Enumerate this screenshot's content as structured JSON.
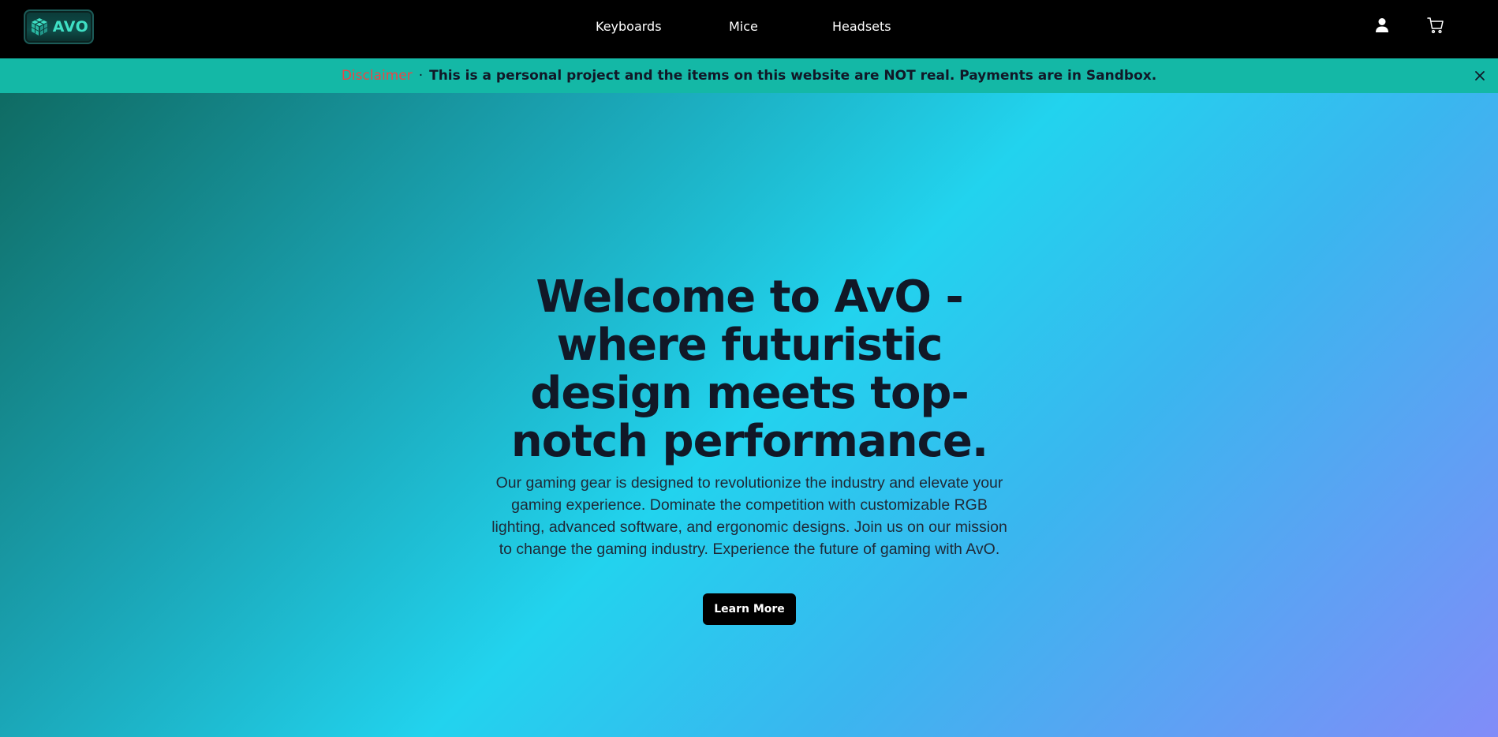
{
  "brand": {
    "logo_text": "AVO",
    "logo_icon": "cube-logo-icon"
  },
  "nav": {
    "links": [
      {
        "label": "Keyboards"
      },
      {
        "label": "Mice"
      },
      {
        "label": "Headsets"
      }
    ],
    "icons": [
      "user-icon",
      "cart-icon"
    ]
  },
  "banner": {
    "label": "Disclaimer",
    "separator": "·",
    "text": "This is a personal project and the items on this website are NOT real. Payments are in Sandbox.",
    "close_icon": "close-icon"
  },
  "hero": {
    "title": "Welcome to AvO - where futuristic design meets top-notch performance.",
    "description": "Our gaming gear is designed to revolutionize the industry and elevate your gaming experience. Dominate the competition with customizable RGB lighting, advanced software, and ergonomic designs. Join us on our mission to change the gaming industry. Experience the future of gaming with AvO.",
    "cta_label": "Learn More"
  },
  "colors": {
    "navbar_bg": "#000000",
    "banner_bg": "#14b8a6",
    "disclaimer_red": "#ef4444",
    "hero_gradient_start": "#0f6b63",
    "hero_gradient_mid": "#22d3ee",
    "hero_gradient_end": "#818cf8",
    "title_text": "#111827"
  }
}
